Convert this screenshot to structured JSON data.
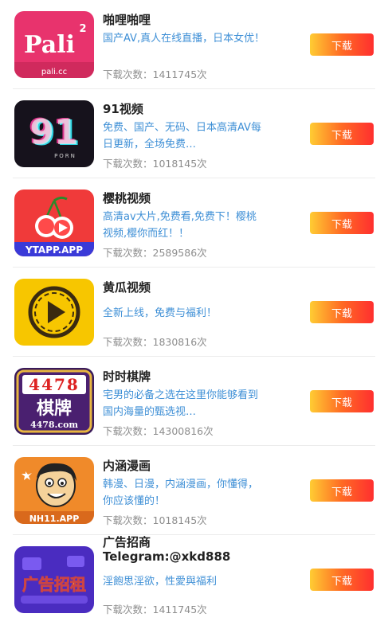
{
  "download_label": "下载",
  "items": [
    {
      "name": "啪哩啪哩",
      "desc": "国产AV,真人在线直播，日本女优！",
      "count": "下载次数：1411745次",
      "icon": "pali-logo-icon",
      "icon_text": "Pali",
      "icon_sup": "2",
      "icon_sub": "pali.cc"
    },
    {
      "name": "91视频",
      "desc": "免费、国产、无码、日本高清AV每日更新，全场免费…",
      "count": "下载次数：1018145次",
      "icon": "91-logo-icon",
      "icon_text": "91",
      "icon_sub": "PORN"
    },
    {
      "name": "樱桃视频",
      "desc": "高清av大片,免费看,免费下！樱桃视频,樱你而红！！",
      "count": "下载次数：2589586次",
      "icon": "cherry-logo-icon",
      "icon_sub": "YTAPP.APP"
    },
    {
      "name": "黄瓜视频",
      "desc": "全新上线，免费与福利！",
      "count": "下载次数：1830816次",
      "icon": "play-logo-icon"
    },
    {
      "name": "时时棋牌",
      "desc": "宅男的必备之选在这里你能够看到国内海量的甄选视…",
      "count": "下载次数：14300816次",
      "icon": "chess-logo-icon",
      "icon_text": "4478",
      "icon_mid": "棋牌",
      "icon_sub": "4478.com"
    },
    {
      "name": "内涵漫画",
      "desc": "韩漫、日漫，内涵漫画，你懂得，你应该懂的！",
      "count": "下载次数：1018145次",
      "icon": "cartoon-logo-icon",
      "icon_sub": "NH11.APP"
    },
    {
      "name": "广告招商",
      "subname": "Telegram:@xkd888",
      "desc": "淫飽思淫欲，性愛與福利",
      "count": "下载次数：1411745次",
      "icon": "ad-logo-icon",
      "icon_text": "广告招租"
    }
  ],
  "colors": {
    "desc": "#3e8fd6",
    "button_start": "#ffcc33",
    "button_end": "#ff2f2f"
  }
}
